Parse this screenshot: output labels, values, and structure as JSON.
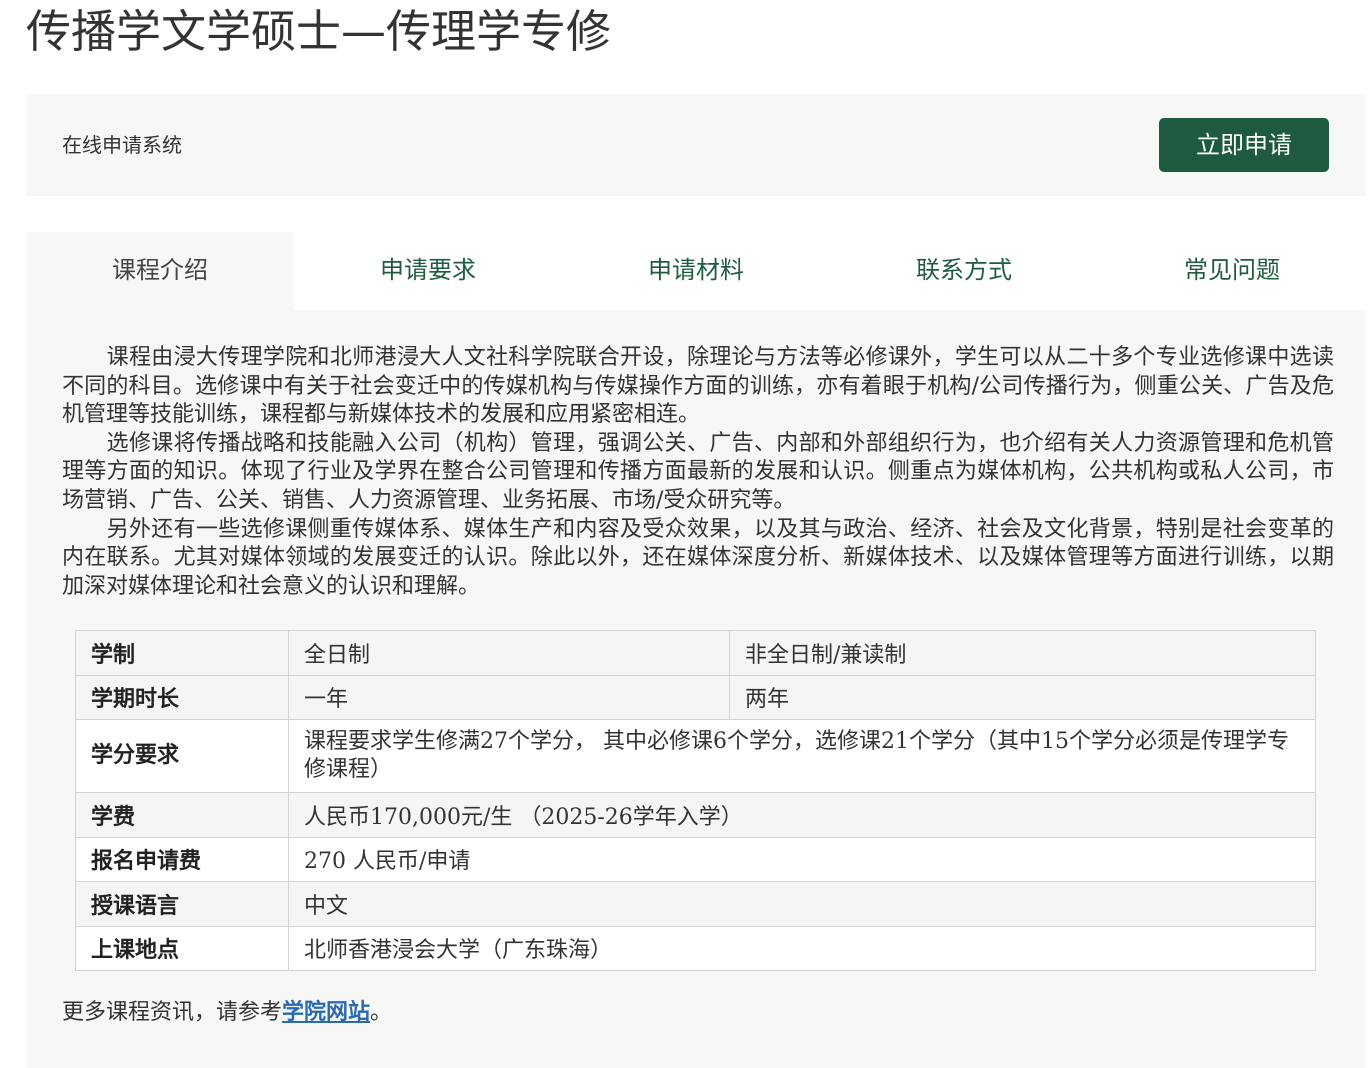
{
  "page": {
    "title": "传播学文学硕士—传理学专修"
  },
  "apply_bar": {
    "system_label": "在线申请系统",
    "apply_button": "立即申请"
  },
  "tabs": [
    {
      "label": "课程介绍",
      "active": true
    },
    {
      "label": "申请要求",
      "active": false
    },
    {
      "label": "申请材料",
      "active": false
    },
    {
      "label": "联系方式",
      "active": false
    },
    {
      "label": "常见问题",
      "active": false
    }
  ],
  "intro": {
    "paragraphs": [
      "　　课程由浸大传理学院和北师港浸大人文社科学院联合开设，除理论与方法等必修课外，学生可以从二十多个专业选修课中选读不同的科目。选修课中有关于社会变迁中的传媒机构与传媒操作方面的训练，亦有着眼于机构/公司传播行为，侧重公关、广告及危机管理等技能训练，课程都与新媒体技术的发展和应用紧密相连。",
      "　　选修课将传播战略和技能融入公司（机构）管理，强调公关、广告、内部和外部组织行为，也介绍有关人力资源管理和危机管理等方面的知识。体现了行业及学界在整合公司管理和传播方面最新的发展和认识。侧重点为媒体机构，公共机构或私人公司，市场营销、广告、公关、销售、人力资源管理、业务拓展、市场/受众研究等。",
      "　　另外还有一些选修课侧重传媒体系、媒体生产和内容及受众效果，以及其与政治、经济、社会及文化背景，特别是社会变革的内在联系。尤其对媒体领域的发展变迁的认识。除此以外，还在媒体深度分析、新媒体技术、以及媒体管理等方面进行训练，以期加深对媒体理论和社会意义的认识和理解。"
    ]
  },
  "table": {
    "rows": [
      {
        "label": "学制",
        "c1": "全日制",
        "c2": "非全日制/兼读制"
      },
      {
        "label": "学期时长",
        "c1": "一年",
        "c2": "两年"
      },
      {
        "label": "学分要求",
        "value": "课程要求学生修满27个学分， 其中必修课6个学分，选修课21个学分（其中15个学分必须是传理学专修课程）"
      },
      {
        "label": "学费",
        "value": "人民币170,000元/生 （2025-26学年入学）"
      },
      {
        "label": "报名申请费",
        "value": "270 人民币/申请"
      },
      {
        "label": "授课语言",
        "value": "中文"
      },
      {
        "label": "上课地点",
        "value": "北师香港浸会大学（广东珠海）"
      }
    ]
  },
  "more_info": {
    "prefix": "更多课程资讯，请参考",
    "link_text": "学院网站",
    "suffix": "。"
  },
  "colors": {
    "accent": "#1e5a3f",
    "tab_text": "#1f5c40",
    "panel_bg": "#f7f7f6",
    "link": "#2a6ab0"
  }
}
